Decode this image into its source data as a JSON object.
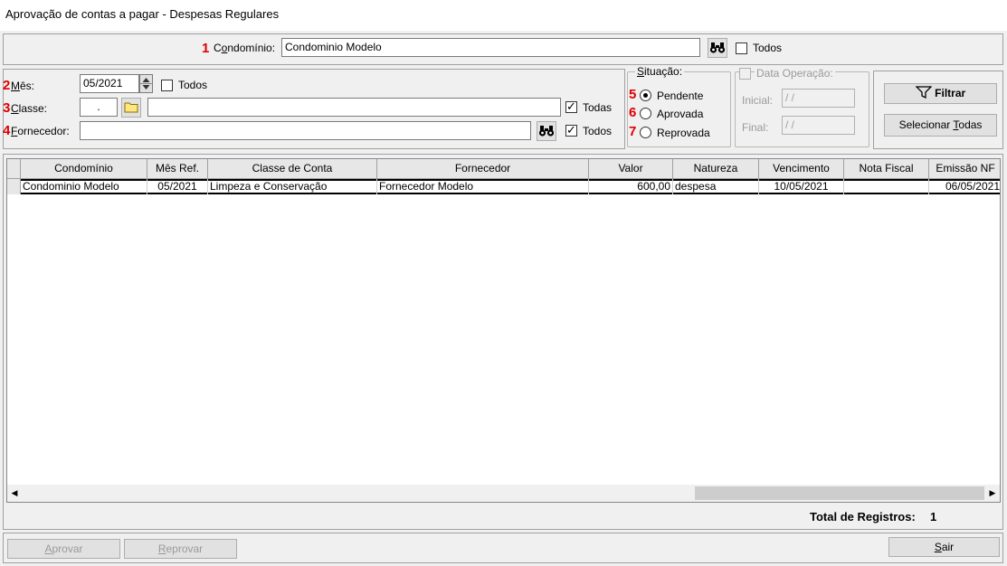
{
  "window": {
    "title": "Aprovação de contas a pagar - Despesas Regulares"
  },
  "condominio": {
    "marker": "1",
    "label_pre": "C",
    "label_u": "o",
    "label_post": "ndomínio:",
    "value": "Condominio Modelo",
    "todos_label": "Todos",
    "todos_checked": false
  },
  "filters": {
    "mes": {
      "marker": "2",
      "label_u": "M",
      "label_post": "ês:",
      "value": "05/2021",
      "todos_label": "Todos",
      "todos_checked": false
    },
    "classe": {
      "marker": "3",
      "label_u": "C",
      "label_post": "lasse:",
      "code": ".",
      "value": "",
      "todas_label": "Todas",
      "todas_checked": true
    },
    "fornecedor": {
      "marker": "4",
      "label_u": "F",
      "label_post": "ornecedor:",
      "value": "",
      "todos_label": "Todos",
      "todos_checked": true
    }
  },
  "situacao": {
    "label_u": "S",
    "label_post": "ituação:",
    "options": [
      {
        "marker": "5",
        "label": "Pendente",
        "selected": true
      },
      {
        "marker": "6",
        "label": "Aprovada",
        "selected": false
      },
      {
        "marker": "7",
        "label": "Reprovada",
        "selected": false
      }
    ]
  },
  "data_operacao": {
    "label": "Data Operação:",
    "inicial_label": "Inicial:",
    "inicial_value": " / /",
    "final_label": "Final:",
    "final_value": " / /"
  },
  "actions": {
    "filtrar_label": "Filtrar",
    "selecionar_pre": "Selecionar ",
    "selecionar_u": "T",
    "selecionar_post": "odas"
  },
  "grid": {
    "headers": [
      "Condomínio",
      "Mês Ref.",
      "Classe de Conta",
      "Fornecedor",
      "Valor",
      "Natureza",
      "Vencimento",
      "Nota Fiscal",
      "Emissão NF"
    ],
    "rows": [
      [
        "Condominio Modelo",
        "05/2021",
        "Limpeza e Conservação",
        "Fornecedor Modelo",
        "600,00",
        "despesa",
        "10/05/2021",
        "",
        "06/05/2021"
      ]
    ]
  },
  "footer": {
    "total_label": "Total de Registros:",
    "total_value": "1"
  },
  "buttons": {
    "aprovar_u": "A",
    "aprovar_post": "provar",
    "reprovar_u": "R",
    "reprovar_post": "eprovar",
    "sair_u": "S",
    "sair_post": "air"
  },
  "icons": {
    "binoculars": "binoculars-icon",
    "folder": "folder-icon",
    "filter": "funnel-icon",
    "spin": "spin-updown-icon"
  }
}
